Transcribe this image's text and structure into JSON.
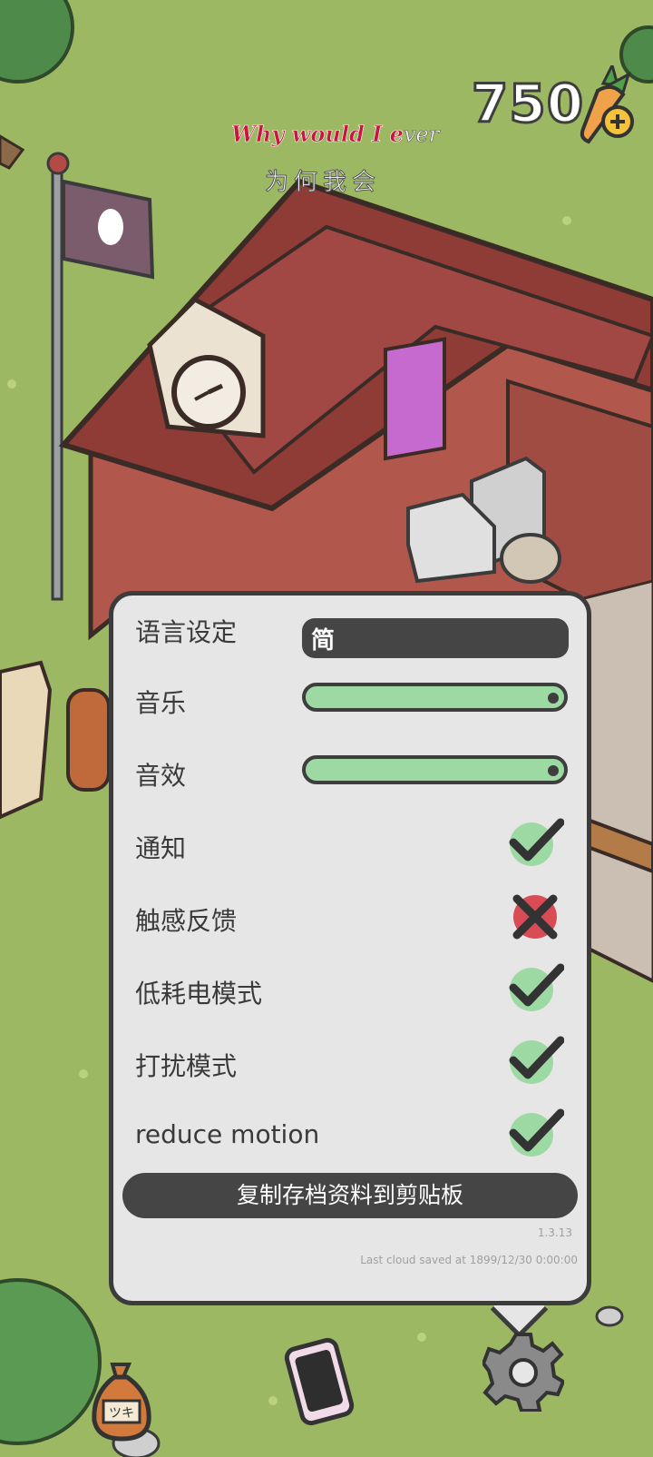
{
  "hud": {
    "carrot_count": "750",
    "caption_en_main": "Why would I e",
    "caption_en_tail": "ver",
    "caption_zh": "为何我会"
  },
  "settings": {
    "language_label": "语言设定",
    "language_value": "简",
    "music_label": "音乐",
    "music_level": 1.0,
    "sfx_label": "音效",
    "sfx_level": 1.0,
    "notifications_label": "通知",
    "notifications_on": true,
    "haptics_label": "触感反馈",
    "haptics_on": false,
    "low_power_label": "低耗电模式",
    "low_power_on": true,
    "dnd_label": "打扰模式",
    "dnd_on": true,
    "reduce_motion_label": "reduce motion",
    "reduce_motion_on": true,
    "copy_save_button": "复制存档资料到剪贴板",
    "version": "1.3.13",
    "cloud_status": "Last cloud saved at 1899/12/30 0:00:00"
  },
  "bag_label": "ツキ",
  "colors": {
    "grass": "#9cb862",
    "panel_bg": "#e6e6e6",
    "panel_border": "#3c3c3c",
    "slider_fill": "#9dd9a3",
    "check_green": "#9dd9a3",
    "cross_red": "#d94b55"
  },
  "icons": {
    "carrot": "carrot-plus-icon",
    "check": "check-icon",
    "cross": "cross-icon",
    "bag": "bag-icon",
    "phone": "phone-icon",
    "gear": "gear-icon"
  }
}
